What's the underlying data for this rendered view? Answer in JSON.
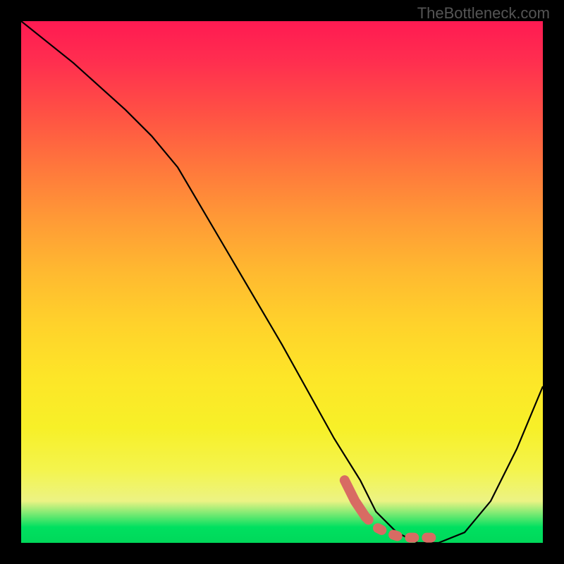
{
  "watermark": "TheBottleneck.com",
  "chart_data": {
    "type": "line",
    "title": "",
    "xlabel": "",
    "ylabel": "",
    "ylim": [
      0,
      100
    ],
    "xlim": [
      0,
      100
    ],
    "series": [
      {
        "name": "curve",
        "x": [
          0,
          10,
          20,
          25,
          30,
          40,
          50,
          60,
          65,
          68,
          72,
          76,
          80,
          85,
          90,
          95,
          100
        ],
        "y": [
          100,
          92,
          83,
          78,
          72,
          55,
          38,
          20,
          12,
          6,
          2,
          0,
          0,
          2,
          8,
          18,
          30
        ]
      }
    ],
    "highlight_band": {
      "name": "dashed-marker",
      "x": [
        62,
        64,
        66,
        68,
        70,
        73,
        76,
        79
      ],
      "y": [
        12,
        8,
        5,
        3,
        2,
        1,
        1,
        1
      ]
    }
  }
}
